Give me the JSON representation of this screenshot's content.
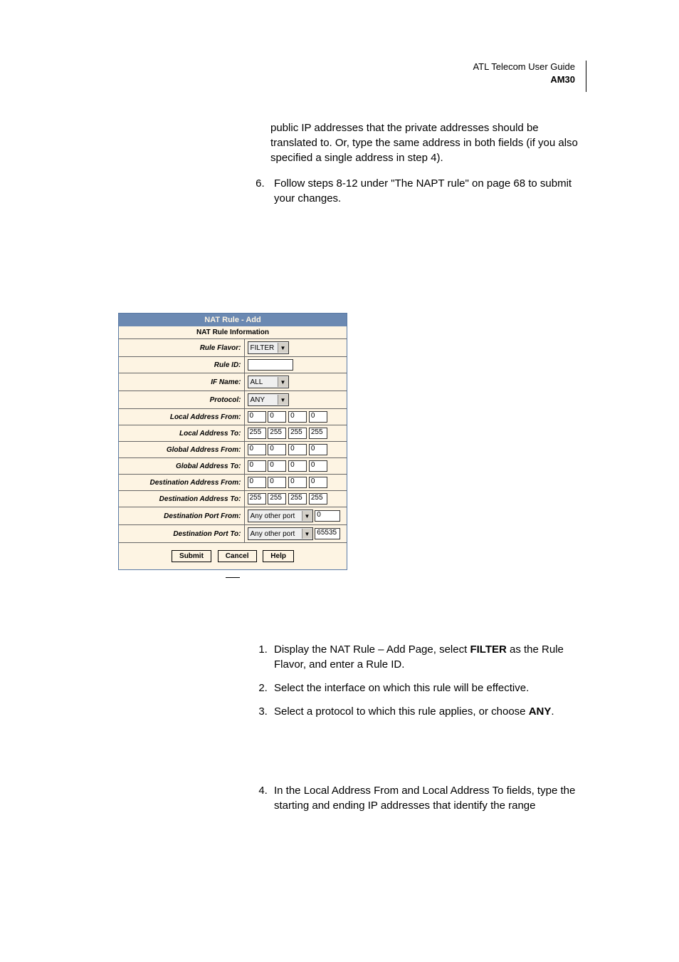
{
  "header": {
    "guide": "ATL Telecom User Guide",
    "model": "AM30"
  },
  "intro_para": "public IP addresses that the private addresses should be translated to. Or, type the same address in both fields (if you also specified a single address in step 4).",
  "step6": "Follow steps 8-12 under \"The NAPT rule\" on page 68 to submit your changes.",
  "figure": {
    "title": "NAT Rule - Add",
    "subtitle": "NAT Rule Information",
    "rows": {
      "rule_flavor": {
        "label": "Rule Flavor:",
        "value": "FILTER"
      },
      "rule_id": {
        "label": "Rule ID:",
        "value": ""
      },
      "if_name": {
        "label": "IF Name:",
        "value": "ALL"
      },
      "protocol": {
        "label": "Protocol:",
        "value": "ANY"
      },
      "local_from": {
        "label": "Local Address From:",
        "oct": [
          "0",
          "0",
          "0",
          "0"
        ]
      },
      "local_to": {
        "label": "Local Address To:",
        "oct": [
          "255",
          "255",
          "255",
          "255"
        ]
      },
      "global_from": {
        "label": "Global Address From:",
        "oct": [
          "0",
          "0",
          "0",
          "0"
        ]
      },
      "global_to": {
        "label": "Global Address To:",
        "oct": [
          "0",
          "0",
          "0",
          "0"
        ]
      },
      "dest_from": {
        "label": "Destination Address From:",
        "oct": [
          "0",
          "0",
          "0",
          "0"
        ]
      },
      "dest_to": {
        "label": "Destination Address To:",
        "oct": [
          "255",
          "255",
          "255",
          "255"
        ]
      },
      "dport_from": {
        "label": "Destination Port From:",
        "sel": "Any other port",
        "num": "0"
      },
      "dport_to": {
        "label": "Destination Port To:",
        "sel": "Any other port",
        "num": "65535"
      }
    },
    "buttons": {
      "submit": "Submit",
      "cancel": "Cancel",
      "help": "Help"
    }
  },
  "steps_after": {
    "s1_a": "Display the NAT Rule – Add Page, select ",
    "s1_b": "FILTER",
    "s1_c": " as the Rule Flavor, and enter a Rule ID.",
    "s2": "Select the interface on which this rule will be effective.",
    "s3_a": "Select a protocol to which this rule applies, or choose ",
    "s3_b": "ANY",
    "s3_c": ".",
    "s4": "In the Local Address From and Local Address To fields, type the starting and ending IP addresses that identify the range"
  }
}
